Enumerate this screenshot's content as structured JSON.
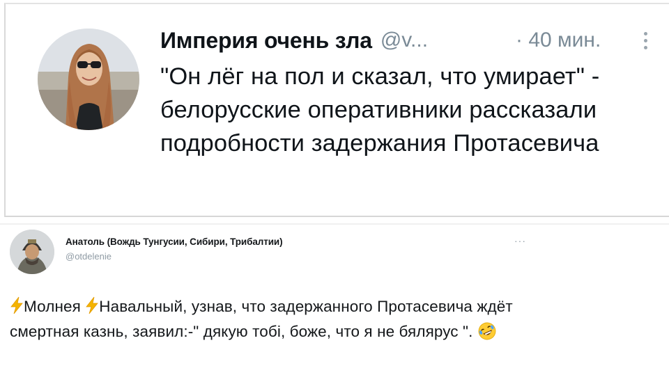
{
  "tweet1": {
    "author_name": "Империя очень зла",
    "handle": "@v...",
    "time": "· 40 мин.",
    "text": "\"Он лёг на пол и сказал, что умирает\" - белорусские оперативники рассказали подробности задержания Протасевича",
    "icons": {
      "more": "more-vertical-icon"
    }
  },
  "tweet2": {
    "author_name": "Анатоль (Вождь Тунгусии, Сибири, Трибалтии)",
    "handle": "@otdelenie",
    "text_part1": "Молнея",
    "text_part2": "Навальный, узнав, что задержанного Протасевича ждёт смертная казнь, заявил:-\" дякую тобі, боже, что я не бялярус \".",
    "icons": {
      "more": "more-horizontal-icon",
      "bolt": "lightning-emoji-icon",
      "laugh": "rolling-laughing-emoji-icon"
    }
  },
  "colors": {
    "secondary_text": "#7a8a96",
    "primary_text": "#0f1419",
    "bolt": "#f4b400",
    "emoji": "#ffcc33"
  }
}
